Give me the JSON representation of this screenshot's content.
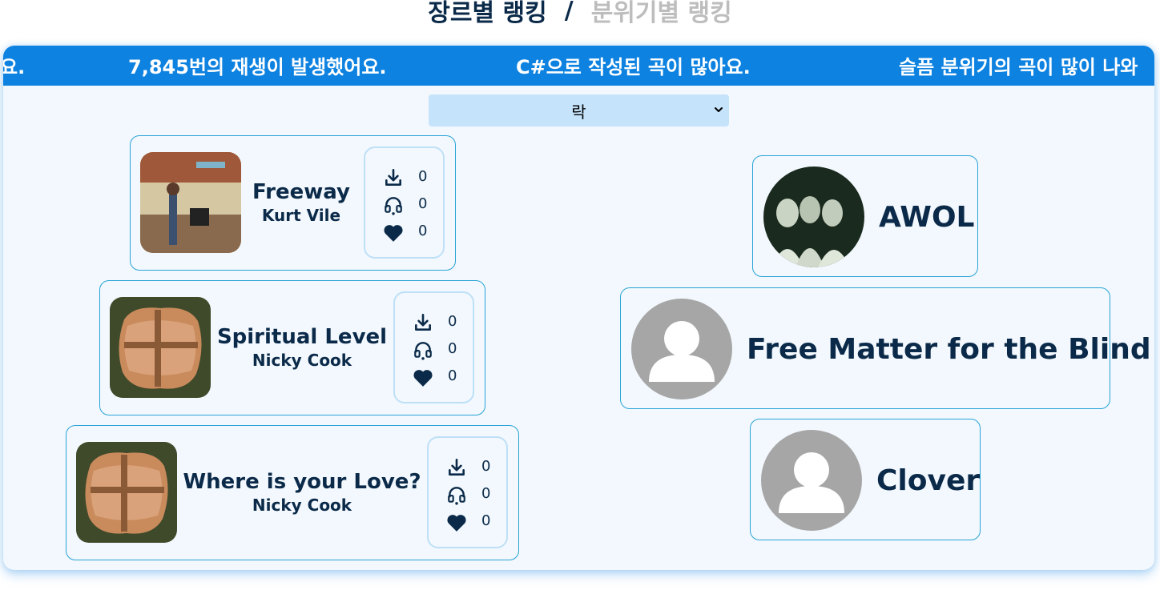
{
  "header": {
    "active_tab": "장르별 랭킹",
    "separator": "/",
    "inactive_tab": "분위기별 랭킹"
  },
  "marquee": {
    "items": [
      "요.",
      "7,845번의 재생이 발생했어요.",
      "C#으로 작성된 곡이 많아요.",
      "슬픔 분위기의 곡이 많이 나와"
    ]
  },
  "genre_select": {
    "selected": "락"
  },
  "songs": [
    {
      "title": "Freeway",
      "artist": "Kurt Vile",
      "downloads": "0",
      "plays": "0",
      "likes": "0"
    },
    {
      "title": "Spiritual Level",
      "artist": "Nicky Cook",
      "downloads": "0",
      "plays": "0",
      "likes": "0"
    },
    {
      "title": "Where is your Love?",
      "artist": "Nicky Cook",
      "downloads": "0",
      "plays": "0",
      "likes": "0"
    }
  ],
  "artists": [
    {
      "name": "AWOL"
    },
    {
      "name": "Free Matter for the Blind"
    },
    {
      "name": "Clover"
    }
  ],
  "icons": {
    "download": "download-icon",
    "plays": "headphones-icon",
    "likes": "heart-icon",
    "select": "chevron-down-icon",
    "default_avatar": "user-avatar-icon"
  },
  "colors": {
    "accent": "#0d82e0",
    "text": "#0b2a49",
    "panel_bg": "#f2f8fd",
    "card_border": "#29a3d6",
    "select_bg": "#c5e3fb",
    "inactive_tab": "#bdbdbd"
  }
}
